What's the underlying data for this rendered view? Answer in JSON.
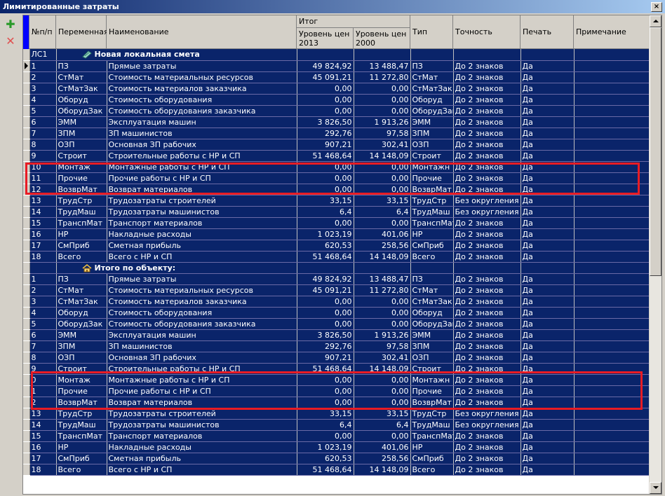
{
  "window": {
    "title": "Лимитированные затраты",
    "close_glyph": "×"
  },
  "toolbar": {
    "add_glyph": "✚",
    "delete_glyph": "✕"
  },
  "columns": {
    "num": "№п/п",
    "var": "Переменная",
    "name": "Наименование",
    "itog": "Итог",
    "p2013": "Уровень цен 2013",
    "p2000": "Уровень цен 2000",
    "type": "Тип",
    "prec": "Точность",
    "print": "Печать",
    "note": "Примечание"
  },
  "colors": {
    "row_bg": "#0a246a",
    "highlight_box": "#e81c24",
    "indicator": "#0000ff"
  },
  "groups": [
    {
      "code": "ЛС1",
      "title": "Новая локальная смета",
      "icon": "estimate-icon",
      "rows": [
        [
          "1",
          "ПЗ",
          "Прямые затраты",
          "49 824,92",
          "13 488,47",
          "ПЗ",
          "До 2 знаков",
          "Да",
          ""
        ],
        [
          "2",
          "СтМат",
          "Стоимость материальных ресурсов",
          "45 091,21",
          "11 272,80",
          "СтМат",
          "До 2 знаков",
          "Да",
          ""
        ],
        [
          "3",
          "СтМатЗак",
          "Стоимость материалов заказчика",
          "0,00",
          "0,00",
          "СтМатЗак",
          "До 2 знаков",
          "Да",
          ""
        ],
        [
          "4",
          "Оборуд",
          "Стоимость оборудования",
          "0,00",
          "0,00",
          "Оборуд",
          "До 2 знаков",
          "Да",
          ""
        ],
        [
          "5",
          "ОборудЗак",
          "Стоимость оборудования заказчика",
          "0,00",
          "0,00",
          "ОборудЗак",
          "До 2 знаков",
          "Да",
          ""
        ],
        [
          "6",
          "ЭММ",
          "Эксплуатация машин",
          "3 826,50",
          "1 913,26",
          "ЭММ",
          "До 2 знаков",
          "Да",
          ""
        ],
        [
          "7",
          "ЗПМ",
          "ЗП машинистов",
          "292,76",
          "97,58",
          "ЗПМ",
          "До 2 знаков",
          "Да",
          ""
        ],
        [
          "8",
          "ОЗП",
          "Основная ЗП рабочих",
          "907,21",
          "302,41",
          "ОЗП",
          "До 2 знаков",
          "Да",
          ""
        ],
        [
          "9",
          "Строит",
          "Строительные работы с НР и СП",
          "51 468,64",
          "14 148,09",
          "Строит",
          "До 2 знаков",
          "Да",
          ""
        ],
        [
          "10",
          "Монтаж",
          "Монтажные работы с НР и СП",
          "0,00",
          "0,00",
          "Монтажн",
          "До 2 знаков",
          "Да",
          ""
        ],
        [
          "11",
          "Прочие",
          "Прочие работы с НР и СП",
          "0,00",
          "0,00",
          "Прочие",
          "До 2 знаков",
          "Да",
          ""
        ],
        [
          "12",
          "ВозврМат",
          "Возврат материалов",
          "0,00",
          "0,00",
          "ВозврМат",
          "До 2 знаков",
          "Да",
          ""
        ],
        [
          "13",
          "ТрудСтр",
          "Трудозатраты строителей",
          "33,15",
          "33,15",
          "ТрудСтр",
          "Без округления",
          "Да",
          ""
        ],
        [
          "14",
          "ТрудМаш",
          "Трудозатраты машинистов",
          "6,4",
          "6,4",
          "ТрудМаш",
          "Без округления",
          "Да",
          ""
        ],
        [
          "15",
          "ТранспМат",
          "Транспорт материалов",
          "0,00",
          "0,00",
          "ТранспМат",
          "До 2 знаков",
          "Да",
          ""
        ],
        [
          "16",
          "НР",
          "Накладные расходы",
          "1 023,19",
          "401,06",
          "НР",
          "До 2 знаков",
          "Да",
          ""
        ],
        [
          "17",
          "СмПриб",
          "Сметная прибыль",
          "620,53",
          "258,56",
          "СмПриб",
          "До 2 знаков",
          "Да",
          ""
        ],
        [
          "18",
          "Всего",
          "Всего с НР и СП",
          "51 468,64",
          "14 148,09",
          "Всего",
          "До 2 знаков",
          "Да",
          ""
        ]
      ]
    },
    {
      "code": "",
      "title": "Итого по объекту:",
      "icon": "house-icon",
      "rows": [
        [
          "1",
          "ПЗ",
          "Прямые затраты",
          "49 824,92",
          "13 488,47",
          "ПЗ",
          "До 2 знаков",
          "Да",
          ""
        ],
        [
          "2",
          "СтМат",
          "Стоимость материальных ресурсов",
          "45 091,21",
          "11 272,80",
          "СтМат",
          "До 2 знаков",
          "Да",
          ""
        ],
        [
          "3",
          "СтМатЗак",
          "Стоимость материалов заказчика",
          "0,00",
          "0,00",
          "СтМатЗак",
          "До 2 знаков",
          "Да",
          ""
        ],
        [
          "4",
          "Оборуд",
          "Стоимость оборудования",
          "0,00",
          "0,00",
          "Оборуд",
          "До 2 знаков",
          "Да",
          ""
        ],
        [
          "5",
          "ОборудЗак",
          "Стоимость оборудования заказчика",
          "0,00",
          "0,00",
          "ОборудЗак",
          "До 2 знаков",
          "Да",
          ""
        ],
        [
          "6",
          "ЭММ",
          "Эксплуатация машин",
          "3 826,50",
          "1 913,26",
          "ЭММ",
          "До 2 знаков",
          "Да",
          ""
        ],
        [
          "7",
          "ЗПМ",
          "ЗП машинистов",
          "292,76",
          "97,58",
          "ЗПМ",
          "До 2 знаков",
          "Да",
          ""
        ],
        [
          "8",
          "ОЗП",
          "Основная ЗП рабочих",
          "907,21",
          "302,41",
          "ОЗП",
          "До 2 знаков",
          "Да",
          ""
        ],
        [
          "9",
          "Строит",
          "Строительные работы с НР и СП",
          "51 468,64",
          "14 148,09",
          "Строит",
          "До 2 знаков",
          "Да",
          ""
        ],
        [
          "0",
          "Монтаж",
          "Монтажные работы с НР и СП",
          "0,00",
          "0,00",
          "Монтажн",
          "До 2 знаков",
          "Да",
          ""
        ],
        [
          "1",
          "Прочие",
          "Прочие работы с НР и СП",
          "0,00",
          "0,00",
          "Прочие",
          "До 2 знаков",
          "Да",
          ""
        ],
        [
          "2",
          "ВозврМат",
          "Возврат материалов",
          "0,00",
          "0,00",
          "ВозврМат",
          "До 2 знаков",
          "Да",
          ""
        ],
        [
          "13",
          "ТрудСтр",
          "Трудозатраты строителей",
          "33,15",
          "33,15",
          "ТрудСтр",
          "Без округления",
          "Да",
          ""
        ],
        [
          "14",
          "ТрудМаш",
          "Трудозатраты машинистов",
          "6,4",
          "6,4",
          "ТрудМаш",
          "Без округления",
          "Да",
          ""
        ],
        [
          "15",
          "ТранспМат",
          "Транспорт материалов",
          "0,00",
          "0,00",
          "ТранспМат",
          "До 2 знаков",
          "Да",
          ""
        ],
        [
          "16",
          "НР",
          "Накладные расходы",
          "1 023,19",
          "401,06",
          "НР",
          "До 2 знаков",
          "Да",
          ""
        ],
        [
          "17",
          "СмПриб",
          "Сметная прибыль",
          "620,53",
          "258,56",
          "СмПриб",
          "До 2 знаков",
          "Да",
          ""
        ],
        [
          "18",
          "Всего",
          "Всего с НР и СП",
          "51 468,64",
          "14 148,09",
          "Всего",
          "До 2 знаков",
          "Да",
          ""
        ]
      ]
    }
  ]
}
